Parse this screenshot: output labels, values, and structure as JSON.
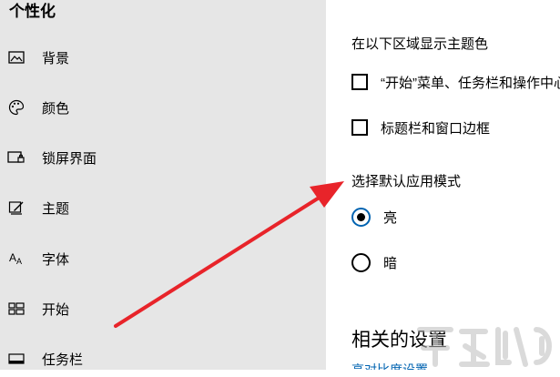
{
  "sidebar": {
    "title": "个性化",
    "items": [
      {
        "label": "背景",
        "icon": "image-icon"
      },
      {
        "label": "颜色",
        "icon": "palette-icon"
      },
      {
        "label": "锁屏界面",
        "icon": "lock-screen-icon"
      },
      {
        "label": "主题",
        "icon": "theme-brush-icon"
      },
      {
        "label": "字体",
        "icon": "font-icon"
      },
      {
        "label": "开始",
        "icon": "start-grid-icon"
      },
      {
        "label": "任务栏",
        "icon": "taskbar-icon"
      }
    ]
  },
  "main": {
    "accent_section_label": "在以下区域显示主题色",
    "checkboxes": [
      {
        "label": "“开始”菜单、任务栏和操作中心",
        "checked": false
      },
      {
        "label": "标题栏和窗口边框",
        "checked": false
      }
    ],
    "mode_section_label": "选择默认应用模式",
    "radios": [
      {
        "label": "亮",
        "selected": true
      },
      {
        "label": "暗",
        "selected": false
      }
    ],
    "related_title": "相关的设置",
    "related_link": "高对比度设置"
  },
  "colors": {
    "sidebar_bg": "#e6e6e6",
    "accent": "#0063b1",
    "annotation_arrow": "#e8242a"
  }
}
